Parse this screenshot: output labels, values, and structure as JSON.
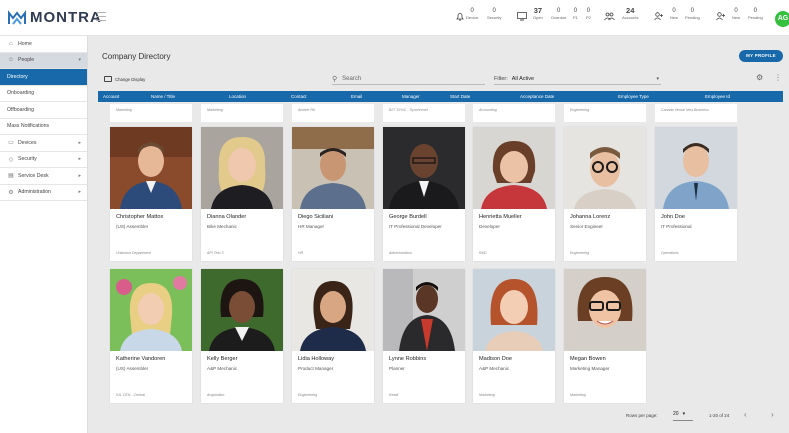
{
  "header": {
    "app_name": "MONTRA",
    "stats": [
      {
        "icon": "bell-icon",
        "value": "0",
        "label": "Device"
      },
      {
        "icon": "bell-icon",
        "value": "0",
        "label": "Security"
      },
      {
        "icon": "monitor-icon",
        "value": "37",
        "label": "Open"
      },
      {
        "icon": "monitor-icon",
        "value": "0",
        "label": "Overdue"
      },
      {
        "icon": "monitor-icon",
        "value": "0",
        "label": "P1"
      },
      {
        "icon": "monitor-icon",
        "value": "0",
        "label": "P2"
      },
      {
        "icon": "users-icon",
        "value": "24",
        "label": "Accounts"
      },
      {
        "icon": "user-add-icon",
        "value": "0",
        "label": "New"
      },
      {
        "icon": "user-add-icon",
        "value": "0",
        "label": "Pending"
      },
      {
        "icon": "user-add-icon",
        "value": "0",
        "label": "New"
      },
      {
        "icon": "user-add-icon",
        "value": "0",
        "label": "Pending"
      }
    ],
    "avatar_initials": "AG"
  },
  "sidebar": {
    "items": [
      {
        "label": "Home",
        "icon": "home-icon"
      },
      {
        "label": "People",
        "icon": "people-icon"
      },
      {
        "label": "Directory"
      },
      {
        "label": "Onboarding"
      },
      {
        "label": "Offboarding"
      },
      {
        "label": "Mass Notifications"
      },
      {
        "label": "Devices",
        "icon": "devices-icon"
      },
      {
        "label": "Security",
        "icon": "shield-icon"
      },
      {
        "label": "Service Desk",
        "icon": "ticket-icon"
      },
      {
        "label": "Administration",
        "icon": "admin-icon"
      }
    ]
  },
  "main": {
    "title": "Company Directory",
    "my_profile": "MY PROFILE",
    "change_display": "Change Display",
    "search_placeholder": "Search",
    "filter_label": "Filter:",
    "filter_value": "All Active",
    "columns": [
      "Account",
      "Name / Title",
      "Location",
      "Contact",
      "Email",
      "Manager",
      "Start Date",
      "Acceptance Date",
      "Employee Type",
      "Employee Id"
    ],
    "partial_row": [
      "Marketing",
      "Marketing",
      "Ambler PA",
      "",
      "B27 SYNC - Synchronet",
      "Accounting",
      "Engineering",
      "Canada Venue New Business"
    ],
    "cards": [
      {
        "name": "Christopher Mattox",
        "title": "(US) Assembler",
        "dept": "Unknown Department"
      },
      {
        "name": "Dianna Olander",
        "title": "Bike Mechanic",
        "dept": "API Test 3"
      },
      {
        "name": "Diego Siciliani",
        "title": "HR Manager",
        "dept": "HR"
      },
      {
        "name": "George Burdell",
        "title": "IT Professional Developer",
        "dept": "Administration"
      },
      {
        "name": "Henrietta Mueller",
        "title": "Developer",
        "dept": "R&D"
      },
      {
        "name": "Johanna Lorenz",
        "title": "Senior Engineer",
        "dept": "Engineering"
      },
      {
        "name": "John Doe",
        "title": "IT Professional",
        "dept": "Operations"
      },
      {
        "name": "Katherine Vandoren",
        "title": "(US) Assembler",
        "dept": "011 CEN - Central"
      },
      {
        "name": "Kelly Berger",
        "title": "A&P Mechanic",
        "dept": "Acquisition"
      },
      {
        "name": "Lidia Holloway",
        "title": "Product Manager",
        "dept": "Engineering"
      },
      {
        "name": "Lynne Robbins",
        "title": "Planner",
        "dept": "Retail"
      },
      {
        "name": "Madison Doe",
        "title": "A&P Mechanic",
        "dept": "Marketing"
      },
      {
        "name": "Megan Bowen",
        "title": "Marketing Manager",
        "dept": "Marketing"
      }
    ],
    "rows_per_page_label": "Rows per page:",
    "rows_per_page": "20",
    "range": "1-20 of 24"
  }
}
